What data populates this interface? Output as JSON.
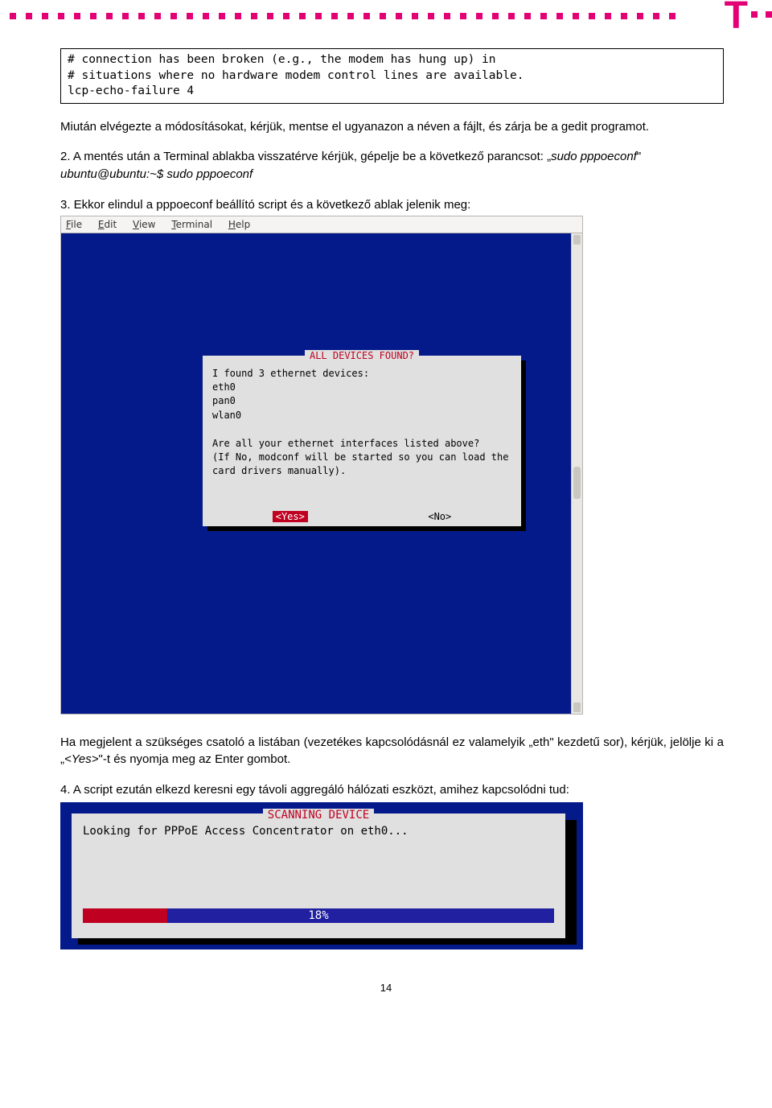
{
  "code_box": "# connection has been broken (e.g., the modem has hung up) in\n# situations where no hardware modem control lines are available.\nlcp-echo-failure 4",
  "para1": "Miután elvégezte a módosításokat, kérjük, mentse el ugyanazon a néven a fájlt, és zárja be a gedit programot.",
  "step2_prefix": "2. A mentés után a Terminal ablakba visszatérve kérjük, gépelje be a következő parancsot: „",
  "step2_cmd": "sudo pppoeconf",
  "step2_suffix": "\"",
  "step2_prompt": "ubuntu@ubuntu:~$ sudo pppoeconf",
  "step3": "3. Ekkor elindul a pppoeconf beállító script és a következő ablak jelenik meg:",
  "term_menu": {
    "file": "File",
    "edit": "Edit",
    "view": "View",
    "terminal": "Terminal",
    "help": "Help"
  },
  "dialog1": {
    "title": "ALL DEVICES FOUND?",
    "body": "I found 3 ethernet devices:\neth0\npan0\nwlan0\n\nAre all your ethernet interfaces listed above?\n(If No, modconf will be started so you can load the\ncard drivers manually).",
    "yes": "<Yes>",
    "no": "<No>"
  },
  "para_after1": "Ha megjelent a szükséges csatoló a listában (vezetékes kapcsolódásnál ez valamelyik „eth\" kezdetű sor), kérjük, jelölje ki a „",
  "para_after1_yes": "<Yes>",
  "para_after1_end": "\"-t és nyomja meg az Enter gombot.",
  "step4": "4. A script ezután elkezd keresni egy távoli aggregáló hálózati eszközt, amihez kapcsolódni tud:",
  "scan": {
    "title": "SCANNING DEVICE",
    "text": "Looking for PPPoE Access Concentrator on eth0...",
    "percent": "18%"
  },
  "page_number": "14"
}
